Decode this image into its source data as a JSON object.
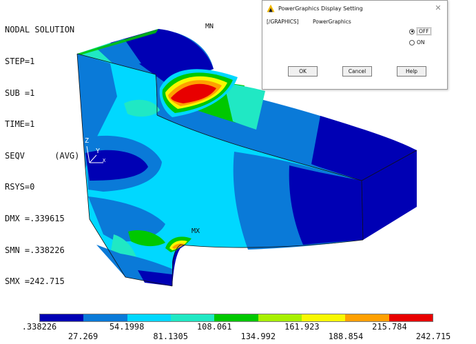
{
  "plot": {
    "header": "NODAL SOLUTION",
    "lines": [
      "STEP=1",
      "SUB =1",
      "TIME=1",
      "SEQV      (AVG)",
      "RSYS=0",
      "DMX =.339615",
      "SMN =.338226",
      "SMX =242.715"
    ],
    "mn_label": "MN",
    "mx_label": "MX",
    "axis_y": "Y",
    "axis_z": "Z",
    "axis_x": "X"
  },
  "colormap": {
    "colors": [
      "#0000b4",
      "#0a7ad8",
      "#00d8ff",
      "#20e8c4",
      "#00c800",
      "#a8f000",
      "#f8f800",
      "#ffa000",
      "#e80000"
    ],
    "labels_top": [
      ".338226",
      "54.1998",
      "108.061",
      "161.923",
      "215.784"
    ],
    "labels_bottom": [
      "27.269",
      "81.1305",
      "134.992",
      "188.854",
      "242.715"
    ]
  },
  "dialog": {
    "title": "PowerGraphics Display Setting",
    "tag": "[/GRAPHICS]",
    "field_label": "PowerGraphics",
    "options": [
      {
        "label": "OFF",
        "selected": true
      },
      {
        "label": "ON",
        "selected": false
      }
    ],
    "buttons": {
      "ok": "OK",
      "cancel": "Cancel",
      "help": "Help"
    }
  }
}
